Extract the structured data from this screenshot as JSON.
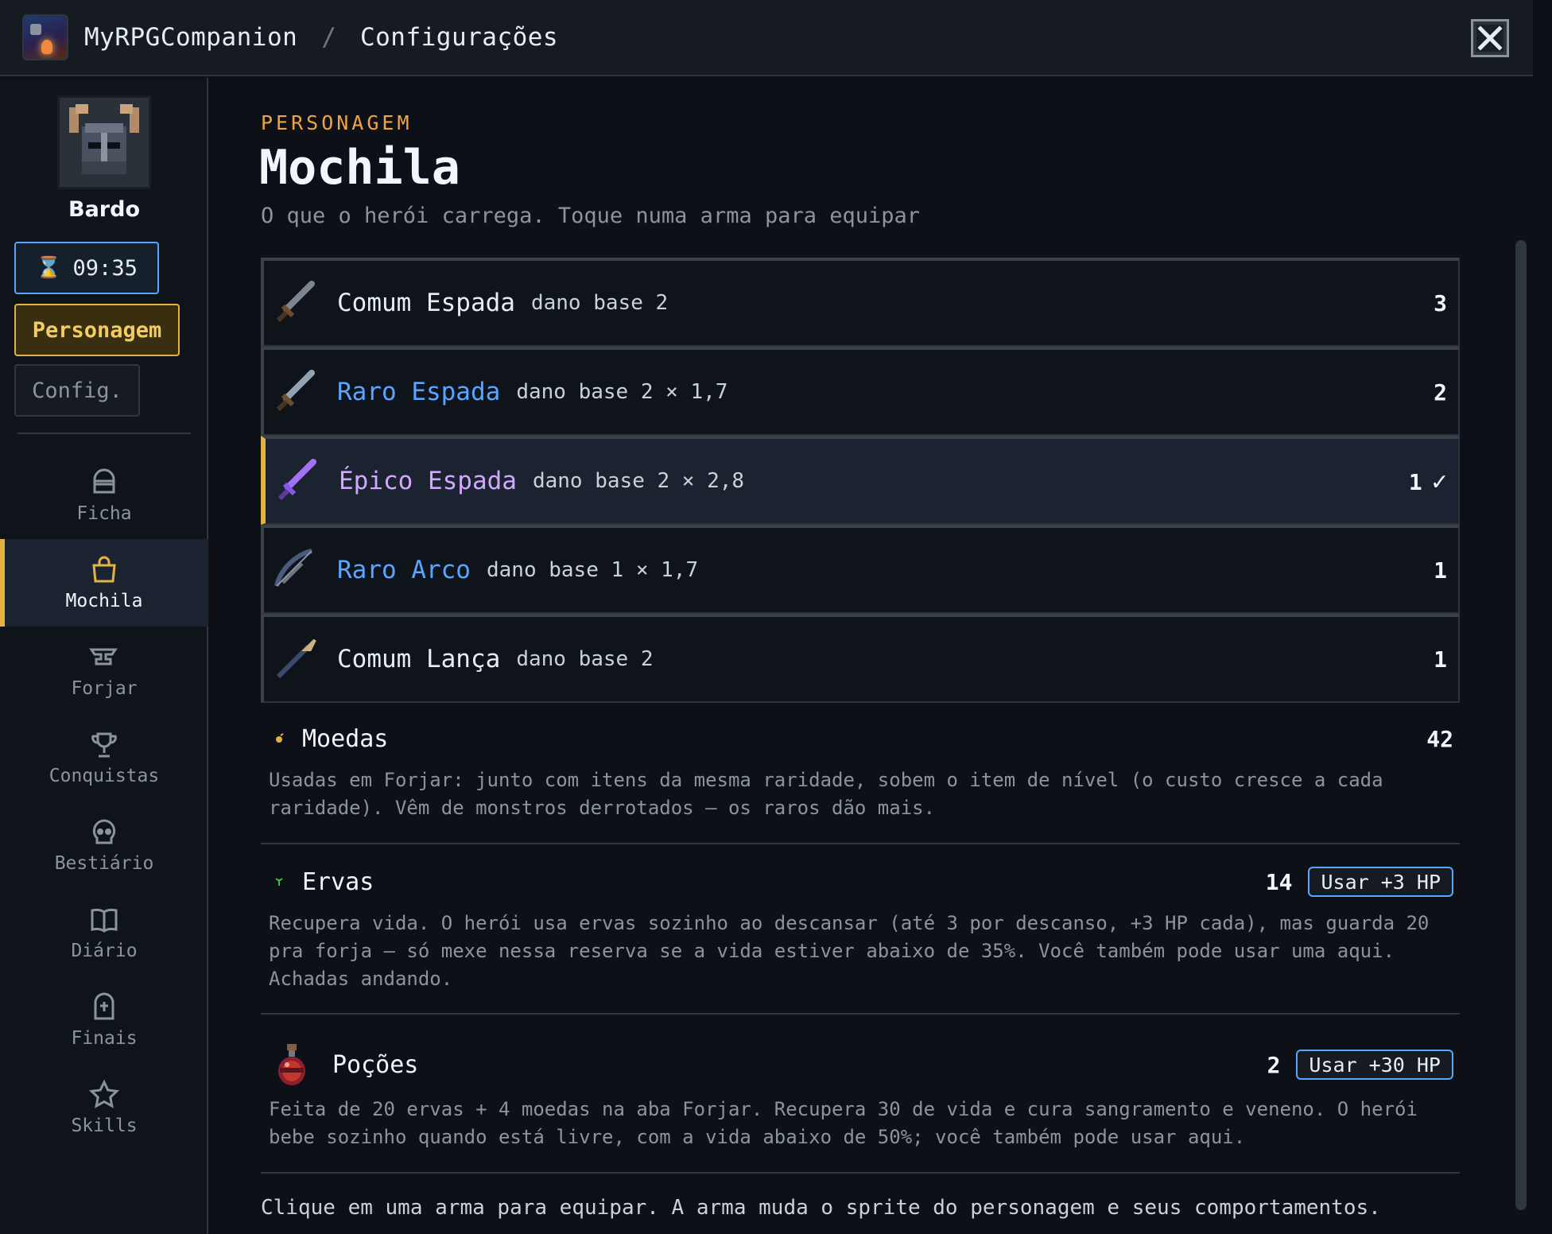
{
  "header": {
    "app_name": "MyRPGCompanion",
    "separator": "/",
    "section": "Configurações"
  },
  "sidebar": {
    "hero_name": "Bardo",
    "timer": "09:35",
    "character_label": "Personagem",
    "config_label": "Config.",
    "nav": [
      {
        "label": "Ficha",
        "icon": "helmet-icon"
      },
      {
        "label": "Mochila",
        "icon": "backpack-icon",
        "active": true
      },
      {
        "label": "Forjar",
        "icon": "anvil-icon"
      },
      {
        "label": "Conquistas",
        "icon": "trophy-icon"
      },
      {
        "label": "Bestiário",
        "icon": "skull-icon"
      },
      {
        "label": "Diário",
        "icon": "book-icon"
      },
      {
        "label": "Finais",
        "icon": "tombstone-icon"
      },
      {
        "label": "Skills",
        "icon": "star-icon"
      }
    ]
  },
  "main": {
    "kicker": "PERSONAGEM",
    "title": "Mochila",
    "subtitle": "O que o herói carrega. Toque numa arma para equipar",
    "weapons": [
      {
        "name": "Comum Espada",
        "desc": "dano base 2",
        "qty": "3",
        "rarity": "common"
      },
      {
        "name": "Raro Espada",
        "desc": "dano base 2 × 1,7",
        "qty": "2",
        "rarity": "rare"
      },
      {
        "name": "Épico Espada",
        "desc": "dano base 2 × 2,8",
        "qty": "1",
        "rarity": "epic",
        "equipped": true,
        "check": "✓"
      },
      {
        "name": "Raro Arco",
        "desc": "dano base 1 × 1,7",
        "qty": "1",
        "rarity": "rare"
      },
      {
        "name": "Comum Lança",
        "desc": "dano base 2",
        "qty": "1",
        "rarity": "common"
      }
    ],
    "resources": [
      {
        "name": "Moedas",
        "qty": "42",
        "icon": "coin-icon",
        "desc": "Usadas em Forjar: junto com itens da mesma raridade, sobem o item de nível (o custo cresce a cada raridade). Vêm de monstros derrotados — os raros dão mais."
      },
      {
        "name": "Ervas",
        "qty": "14",
        "icon": "herb-icon",
        "button": "Usar +3 HP",
        "desc": "Recupera vida. O herói usa ervas sozinho ao descansar (até 3 por descanso, +3 HP cada), mas guarda 20 pra forja — só mexe nessa reserva se a vida estiver abaixo de 35%. Você também pode usar uma aqui. Achadas andando."
      },
      {
        "name": "Poções",
        "qty": "2",
        "icon": "potion-icon",
        "button": "Usar +30 HP",
        "desc": "Feita de 20 ervas + 4 moedas na aba Forjar. Recupera 30 de vida e cura sangramento e veneno. O herói bebe sozinho quando está livre, com a vida abaixo de 50%; você também pode usar aqui."
      }
    ],
    "footer": "Clique em uma arma para equipar. A arma muda o sprite do personagem e seus comportamentos."
  },
  "colors": {
    "accent_gold": "#e3b341",
    "rare_blue": "#58a6ff",
    "epic_purple": "#d2a8ff",
    "background": "#0d1117"
  }
}
